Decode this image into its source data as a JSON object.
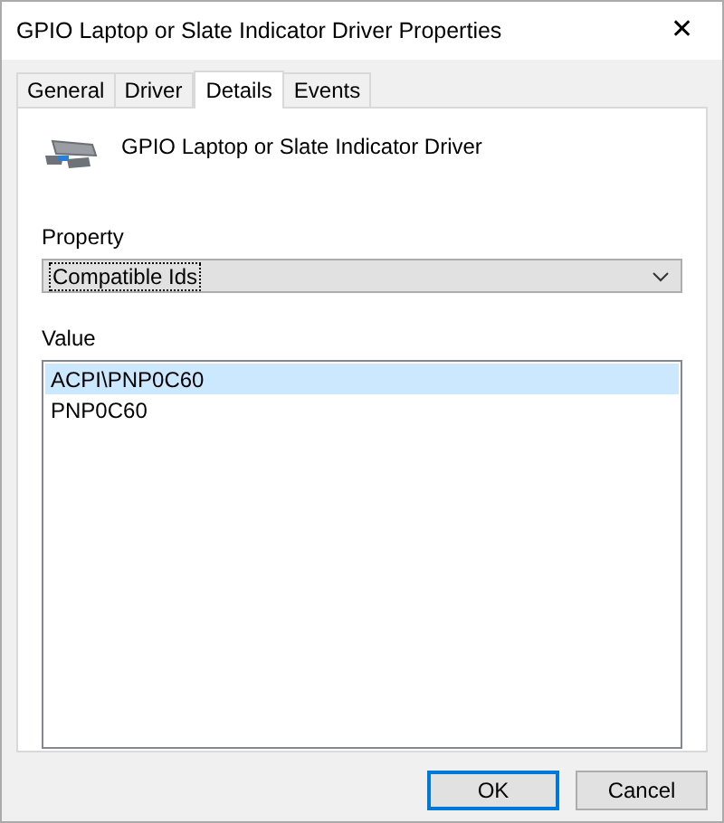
{
  "window": {
    "title": "GPIO Laptop or Slate Indicator Driver Properties",
    "close": "✕"
  },
  "tabs": [
    {
      "label": "General",
      "selected": false
    },
    {
      "label": "Driver",
      "selected": false
    },
    {
      "label": "Details",
      "selected": true
    },
    {
      "label": "Events",
      "selected": false
    }
  ],
  "device": {
    "name": "GPIO Laptop or Slate Indicator Driver"
  },
  "property": {
    "label": "Property",
    "value": "Compatible Ids"
  },
  "value": {
    "label": "Value",
    "items": [
      {
        "text": "ACPI\\PNP0C60",
        "selected": true
      },
      {
        "text": "PNP0C60",
        "selected": false
      }
    ]
  },
  "buttons": [
    {
      "label": "OK",
      "default": true
    },
    {
      "label": "Cancel",
      "default": false
    }
  ]
}
